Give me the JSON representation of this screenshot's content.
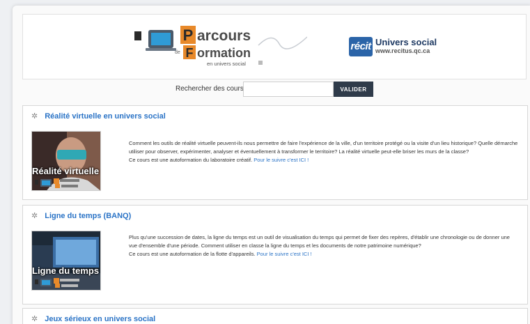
{
  "banner": {
    "logo_letters": [
      "P",
      "F"
    ],
    "logo_text_1": "arcours",
    "logo_text_de": "de",
    "logo_text_2": "ormation",
    "logo_sub": "en univers social",
    "recit_badge": "récit",
    "recit_title": "Univers social",
    "recit_url": "www.recitus.qc.ca"
  },
  "search": {
    "label": "Rechercher des cours:",
    "value": "",
    "button": "VALIDER"
  },
  "courses": [
    {
      "title": "Réalité virtuelle en univers social",
      "thumb_caption": "Réalité virtuelle",
      "paragraph": "Comment les outils de réalité virtuelle peuvent-ils nous permettre de faire l'expérience de la ville, d'un territoire protégé ou la visite d'un lieu historique? Quelle démarche utiliser pour observer, expérimenter, analyser et éventuellement à transformer le territoire? La réalité virtuelle peut-elle briser les murs de la classe?",
      "note": "Ce cours est une autoformation du laboratoire créatif.",
      "link": "Pour le suivre c'est ICI !"
    },
    {
      "title": "Ligne du temps (BANQ)",
      "thumb_caption": "Ligne du temps",
      "paragraph": "Plus qu'une succession de dates, la ligne du temps est un outil de visualisation du temps qui permet de fixer des repères, d'établir une chronologie ou de donner une vue d'ensemble d'une période. Comment utiliser en classe la ligne du temps et les documents de notre patrimoine numérique?",
      "note": "Ce cours est une autoformation de la flotte d'appareils.",
      "link": "Pour le suivre c'est ICI !"
    },
    {
      "title": "Jeux sérieux en univers social"
    }
  ],
  "colors": {
    "link": "#2a73c6",
    "button": "#2f3b4a",
    "recit_blue": "#2b64a8",
    "logo_orange": "#e8892a"
  }
}
